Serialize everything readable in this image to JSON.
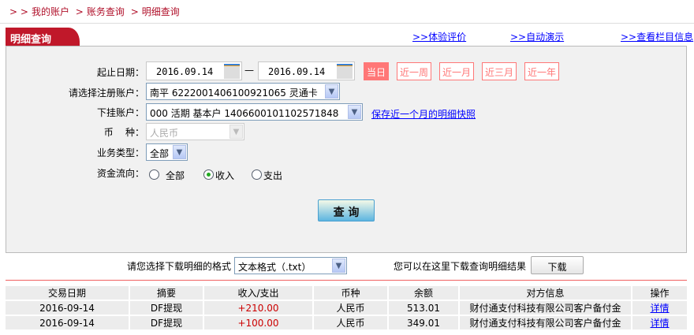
{
  "breadcrumb": [
    "我的账户",
    "账务查询",
    "明细查询"
  ],
  "tab_title": "明细查询",
  "top_links": [
    ">>体验评价",
    ">>自动演示",
    ">>查看栏目信息"
  ],
  "form": {
    "date_label": "起止日期：",
    "start_date": "2016.09.14",
    "date_sep": "—",
    "end_date": "2016.09.14",
    "quick_ranges": [
      "当日",
      "近一周",
      "近一月",
      "近三月",
      "近一年"
    ],
    "account_label": "请选择注册账户：",
    "account_value": "南平  6222001406100921065 灵通卡",
    "sub_account_label": "下挂账户：",
    "sub_account_value": "000 活期 基本户 1406600101102571848",
    "snapshot_link": "保存近一个月的明细快照",
    "currency_label": "币    种：",
    "currency_value": "人民币",
    "biz_type_label": "业务类型：",
    "biz_type_value": "全部",
    "flow_label": "资金流向：",
    "flow_options": [
      "全部",
      "收入",
      "支出"
    ],
    "flow_selected": "收入",
    "query_button": "查 询"
  },
  "download": {
    "format_label": "请您选择下载明细的格式",
    "format_value": "文本格式（.txt）",
    "hint": "您可以在这里下载查询明细结果",
    "button": "下载"
  },
  "table": {
    "headers": [
      "交易日期",
      "摘要",
      "收入/支出",
      "币种",
      "余额",
      "对方信息",
      "操作"
    ],
    "rows": [
      [
        "2016-09-14",
        "DF提现",
        "+210.00",
        "人民币",
        "513.01",
        "财付通支付科技有限公司客户备付金",
        "详情"
      ],
      [
        "2016-09-14",
        "DF提现",
        "+100.00",
        "人民币",
        "349.01",
        "财付通支付科技有限公司客户备付金",
        "详情"
      ]
    ]
  },
  "colors": {
    "brand_red": "#c0182a",
    "quick_red": "#ff7777",
    "amount_red": "#cc0000",
    "link": "#0000ff"
  }
}
